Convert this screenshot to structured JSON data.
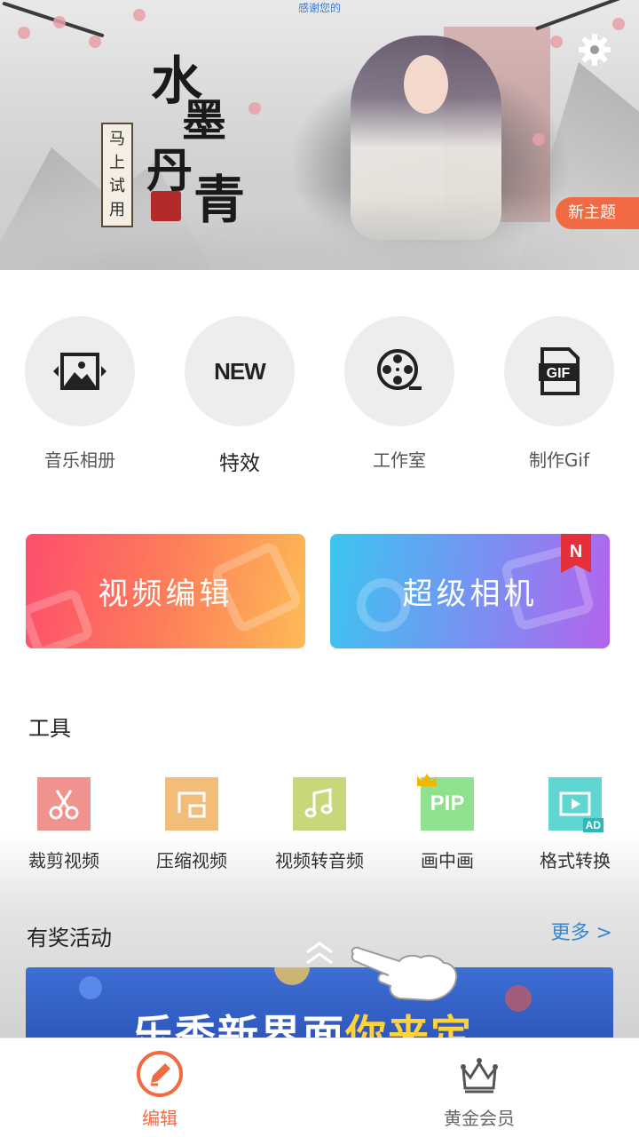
{
  "banner": {
    "top_link": "感谢您的",
    "title_chars": [
      "水",
      "墨",
      "丹",
      "青"
    ],
    "seal_chars": [
      "马",
      "上",
      "试",
      "用"
    ],
    "new_theme": "新主题"
  },
  "features": [
    {
      "label": "音乐相册",
      "icon": "image-slider-icon"
    },
    {
      "label": "特效",
      "icon": "new-icon",
      "icon_text": "NEW"
    },
    {
      "label": "工作室",
      "icon": "film-reel-icon"
    },
    {
      "label": "制作Gif",
      "icon": "gif-icon",
      "icon_text": "GIF"
    }
  ],
  "big_buttons": {
    "video_edit": "视频编辑",
    "super_camera": "超级相机",
    "new_badge": "N"
  },
  "tools": {
    "title": "工具",
    "items": [
      {
        "label": "裁剪视频",
        "icon": "scissors-icon",
        "color": "#f0938e"
      },
      {
        "label": "压缩视频",
        "icon": "compress-icon",
        "color": "#f2bd78"
      },
      {
        "label": "视频转音频",
        "icon": "music-note-icon",
        "color": "#c6d87a"
      },
      {
        "label": "画中画",
        "icon": "pip-icon",
        "color": "#8fe08f",
        "icon_text": "PIP"
      },
      {
        "label": "格式转换",
        "icon": "format-convert-icon",
        "color": "#5fd6d2",
        "badge": "AD"
      }
    ]
  },
  "activities": {
    "title": "有奖活动",
    "more": "更多 >",
    "promo_text_plain": "乐秀新界面",
    "promo_text_highlight": "你来定"
  },
  "bottom_nav": [
    {
      "label": "编辑",
      "icon": "edit-pencil-icon",
      "active": true
    },
    {
      "label": "黄金会员",
      "icon": "crown-icon",
      "active": false
    }
  ],
  "colors": {
    "accent": "#f06a42",
    "link": "#3a86d0"
  }
}
